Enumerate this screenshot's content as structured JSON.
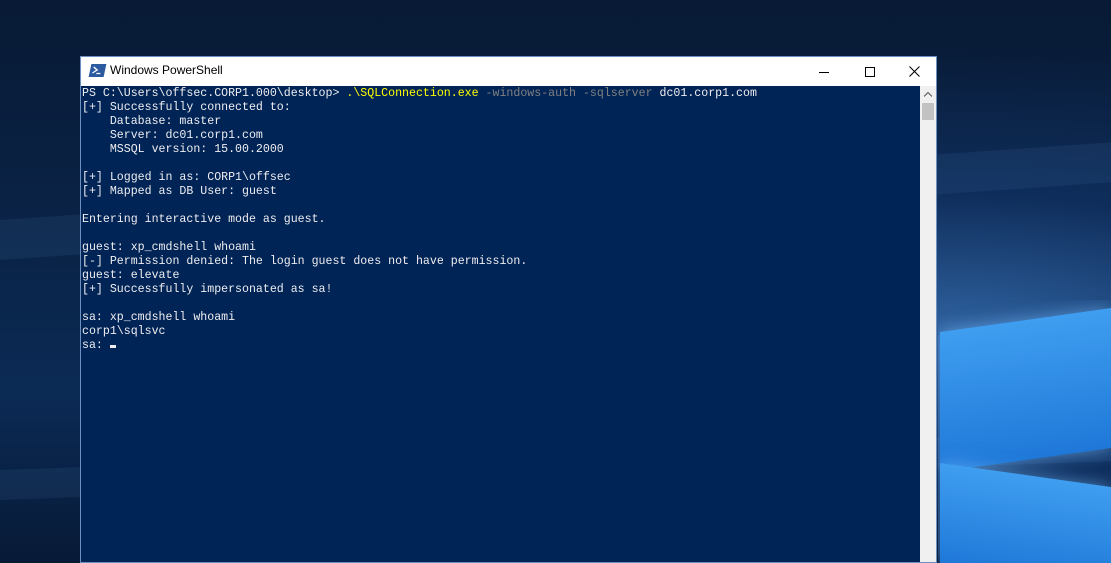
{
  "window": {
    "title": "Windows PowerShell",
    "icon": "powershell-icon",
    "controls": [
      "minimize-icon",
      "maximize-icon",
      "close-icon"
    ]
  },
  "console": {
    "background": "#012456",
    "foreground": "#eeedf0",
    "command_color": "#ffff00",
    "parameter_color": "#808080",
    "prompt": "PS C:\\Users\\offsec.CORP1.000\\desktop> ",
    "command": ".\\SQLConnection.exe",
    "params": " -windows-auth -sqlserver ",
    "argument": "dc01.corp1.com",
    "lines": [
      "[+] Successfully connected to:",
      "    Database: master",
      "    Server: dc01.corp1.com",
      "    MSSQL version: 15.00.2000",
      "",
      "[+] Logged in as: CORP1\\offsec",
      "[+] Mapped as DB User: guest",
      "",
      "Entering interactive mode as guest.",
      "",
      "guest: xp_cmdshell whoami",
      "[-] Permission denied: The login guest does not have permission.",
      "guest: elevate",
      "[+] Successfully impersonated as sa!",
      "",
      "sa: xp_cmdshell whoami",
      "corp1\\sqlsvc"
    ],
    "current_prompt": "sa: "
  }
}
